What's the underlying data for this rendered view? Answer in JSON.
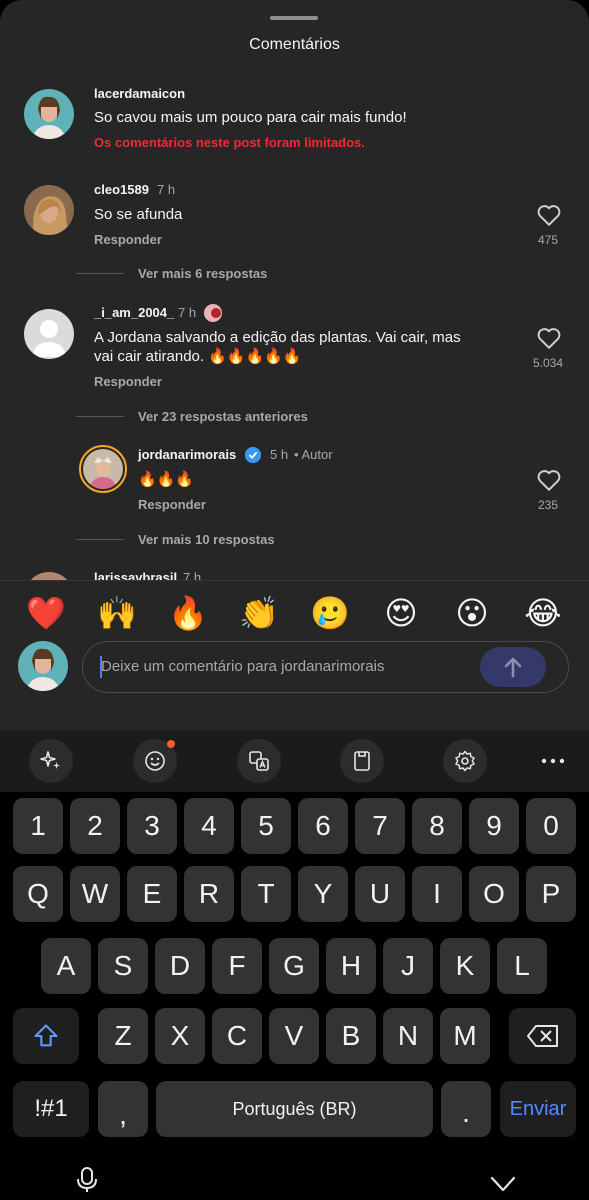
{
  "sheet": {
    "title": "Comentários"
  },
  "comments": [
    {
      "username": "lacerdamaicon",
      "text": "So cavou mais um pouco para cair mais fundo!",
      "limited_notice": "Os comentários neste post foram limitados."
    },
    {
      "username": "cleo1589",
      "time": "7 h",
      "text": "So se afunda",
      "reply": "Responder",
      "likes": "475",
      "more": "Ver mais 6 respostas"
    },
    {
      "username": "_i_am_2004_",
      "time": "7 h",
      "text_line1": "A Jordana salvando a edição das plantas. Vai cair, mas",
      "text_line2": "vai cair atirando. 🔥🔥🔥🔥🔥",
      "reply": "Responder",
      "likes": "5.034",
      "previous": "Ver 23 respostas anteriores"
    },
    {
      "username": "jordanarimorais",
      "time": "5 h",
      "author_label": "• Autor",
      "text": "🔥🔥🔥",
      "reply": "Responder",
      "likes": "235",
      "more": "Ver mais 10 respostas"
    },
    {
      "username": "larissavbrasil",
      "time": "7 h"
    }
  ],
  "emoji_bar": [
    "❤️",
    "🙌",
    "🔥",
    "👏",
    "🥲",
    "😍",
    "😮",
    "😂"
  ],
  "comment_input": {
    "placeholder": "Deixe um comentário para jordanarimorais"
  },
  "keyboard": {
    "toolbar": [
      "sparkle-icon",
      "emoji-icon",
      "translate-icon",
      "clipboard-icon",
      "settings-icon",
      "more-icon"
    ],
    "number_row": [
      "1",
      "2",
      "3",
      "4",
      "5",
      "6",
      "7",
      "8",
      "9",
      "0"
    ],
    "row1": [
      "Q",
      "W",
      "E",
      "R",
      "T",
      "Y",
      "U",
      "I",
      "O",
      "P"
    ],
    "row2": [
      "A",
      "S",
      "D",
      "F",
      "G",
      "H",
      "J",
      "K",
      "L"
    ],
    "row3": [
      "Z",
      "X",
      "C",
      "V",
      "B",
      "N",
      "M"
    ],
    "symbols_key": "!#1",
    "comma_key": ",",
    "space_key": "Português (BR)",
    "period_key": ".",
    "enter_key": "Enviar"
  },
  "colors": {
    "limited_notice": "#ed2b36",
    "enter_key": "#4f8cff",
    "verified": "#3897f0"
  }
}
